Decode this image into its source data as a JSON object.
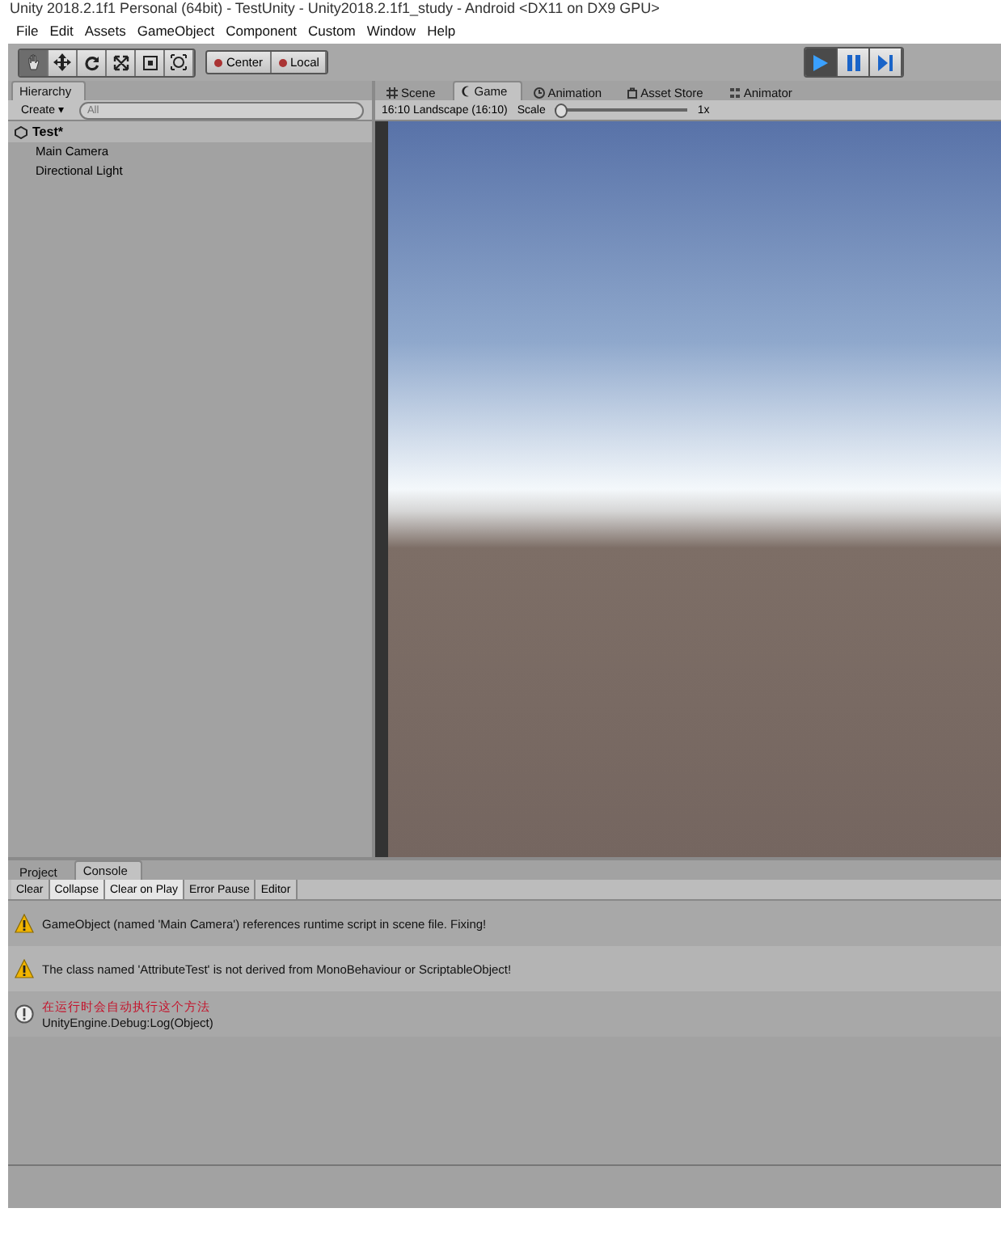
{
  "window": {
    "title": "Unity 2018.2.1f1 Personal (64bit) - TestUnity - Unity2018.2.1f1_study - Android <DX11 on DX9 GPU>"
  },
  "menu": [
    "File",
    "Edit",
    "Assets",
    "GameObject",
    "Component",
    "Custom",
    "Window",
    "Help"
  ],
  "toolbar": {
    "tools": [
      {
        "kind": "hand",
        "selected": true
      },
      {
        "kind": "move",
        "selected": false
      },
      {
        "kind": "rotate",
        "selected": false
      },
      {
        "kind": "scale",
        "selected": false
      },
      {
        "kind": "rect",
        "selected": false
      },
      {
        "kind": "transform",
        "selected": false
      }
    ],
    "pivot": [
      "Center",
      "Local"
    ],
    "playback": [
      {
        "kind": "play",
        "selected": true
      },
      {
        "kind": "pause",
        "selected": false
      },
      {
        "kind": "step",
        "selected": false
      }
    ]
  },
  "hierarchy": {
    "tab": "Hierarchy",
    "create": "Create",
    "create_caret": "▾",
    "search": {
      "placeholder": "All"
    },
    "scene": "Test*",
    "items": [
      "Main Camera",
      "Directional Light"
    ]
  },
  "view_tabs": [
    {
      "label": "Scene",
      "kind": "scene",
      "selected": false
    },
    {
      "label": "Game",
      "kind": "game",
      "selected": true
    },
    {
      "label": "Animation",
      "kind": "animation",
      "selected": false
    },
    {
      "label": "Asset Store",
      "kind": "store",
      "selected": false
    },
    {
      "label": "Animator",
      "kind": "animator",
      "selected": false
    }
  ],
  "game": {
    "aspect": "16:10 Landscape (16:10)",
    "scale_label": "Scale",
    "scale": {
      "level": 0.0
    },
    "scale_reading": "1x"
  },
  "bottom_tabs": [
    {
      "label": "Project",
      "selected": false
    },
    {
      "label": "Console",
      "selected": true
    }
  ],
  "console": {
    "buttons": [
      {
        "label": "Clear",
        "on": false
      },
      {
        "label": "Collapse",
        "on": true
      },
      {
        "label": "Clear on Play",
        "on": true
      },
      {
        "label": "Error Pause",
        "on": false
      },
      {
        "label": "Editor",
        "on": false
      }
    ],
    "messages": [
      {
        "kind": "warning",
        "text": "GameObject (named 'Main Camera') references runtime script in scene file. Fixing!"
      },
      {
        "kind": "warning",
        "text": "The class named 'AttributeTest' is not derived from MonoBehaviour or ScriptableObject!"
      },
      {
        "kind": "info",
        "text": "在运行时会自动执行这个方法",
        "detail": "UnityEngine.Debug:Log(Object)"
      }
    ]
  }
}
